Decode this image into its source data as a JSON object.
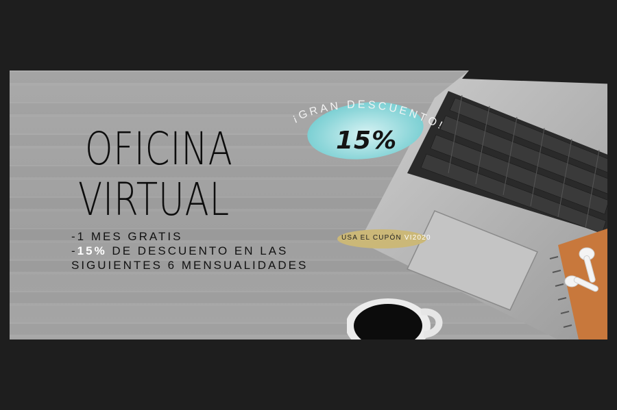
{
  "title": {
    "line1": "OFICINA",
    "line2": "VIRTUAL"
  },
  "bullets": {
    "line1": "-1 MES GRATIS",
    "line2_prefix": "-",
    "line2_highlight": "15%",
    "line2_rest": " DE DESCUENTO EN LAS",
    "line3": "SIGUIENTES 6 MENSUALIDADES"
  },
  "badge": {
    "arc_text": "¡GRAN DESCUENTO!",
    "percent": "15%",
    "color": "#8fd7da"
  },
  "coupon": {
    "label": "USA EL CUPÓN ",
    "code": "VI2020",
    "color": "#cbb878"
  },
  "icons": [
    "laptop-icon",
    "coffee-cup-icon",
    "notebook-icon",
    "earbuds-icon"
  ]
}
